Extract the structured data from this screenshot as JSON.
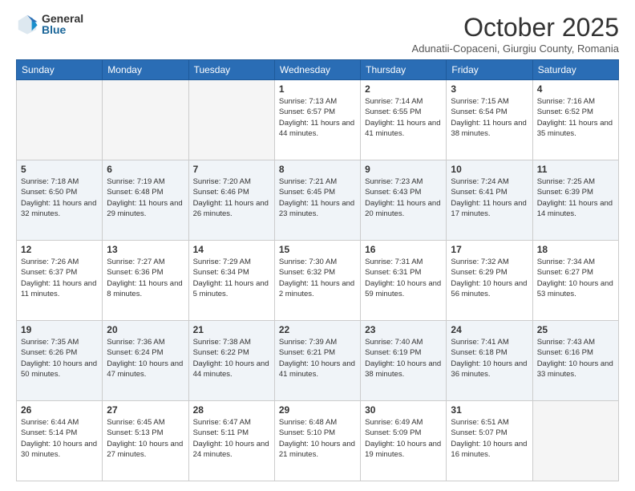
{
  "logo": {
    "general": "General",
    "blue": "Blue"
  },
  "header": {
    "month": "October 2025",
    "subtitle": "Adunatii-Copaceni, Giurgiu County, Romania"
  },
  "weekdays": [
    "Sunday",
    "Monday",
    "Tuesday",
    "Wednesday",
    "Thursday",
    "Friday",
    "Saturday"
  ],
  "weeks": [
    [
      {
        "day": "",
        "info": ""
      },
      {
        "day": "",
        "info": ""
      },
      {
        "day": "",
        "info": ""
      },
      {
        "day": "1",
        "info": "Sunrise: 7:13 AM\nSunset: 6:57 PM\nDaylight: 11 hours and 44 minutes."
      },
      {
        "day": "2",
        "info": "Sunrise: 7:14 AM\nSunset: 6:55 PM\nDaylight: 11 hours and 41 minutes."
      },
      {
        "day": "3",
        "info": "Sunrise: 7:15 AM\nSunset: 6:54 PM\nDaylight: 11 hours and 38 minutes."
      },
      {
        "day": "4",
        "info": "Sunrise: 7:16 AM\nSunset: 6:52 PM\nDaylight: 11 hours and 35 minutes."
      }
    ],
    [
      {
        "day": "5",
        "info": "Sunrise: 7:18 AM\nSunset: 6:50 PM\nDaylight: 11 hours and 32 minutes."
      },
      {
        "day": "6",
        "info": "Sunrise: 7:19 AM\nSunset: 6:48 PM\nDaylight: 11 hours and 29 minutes."
      },
      {
        "day": "7",
        "info": "Sunrise: 7:20 AM\nSunset: 6:46 PM\nDaylight: 11 hours and 26 minutes."
      },
      {
        "day": "8",
        "info": "Sunrise: 7:21 AM\nSunset: 6:45 PM\nDaylight: 11 hours and 23 minutes."
      },
      {
        "day": "9",
        "info": "Sunrise: 7:23 AM\nSunset: 6:43 PM\nDaylight: 11 hours and 20 minutes."
      },
      {
        "day": "10",
        "info": "Sunrise: 7:24 AM\nSunset: 6:41 PM\nDaylight: 11 hours and 17 minutes."
      },
      {
        "day": "11",
        "info": "Sunrise: 7:25 AM\nSunset: 6:39 PM\nDaylight: 11 hours and 14 minutes."
      }
    ],
    [
      {
        "day": "12",
        "info": "Sunrise: 7:26 AM\nSunset: 6:37 PM\nDaylight: 11 hours and 11 minutes."
      },
      {
        "day": "13",
        "info": "Sunrise: 7:27 AM\nSunset: 6:36 PM\nDaylight: 11 hours and 8 minutes."
      },
      {
        "day": "14",
        "info": "Sunrise: 7:29 AM\nSunset: 6:34 PM\nDaylight: 11 hours and 5 minutes."
      },
      {
        "day": "15",
        "info": "Sunrise: 7:30 AM\nSunset: 6:32 PM\nDaylight: 11 hours and 2 minutes."
      },
      {
        "day": "16",
        "info": "Sunrise: 7:31 AM\nSunset: 6:31 PM\nDaylight: 10 hours and 59 minutes."
      },
      {
        "day": "17",
        "info": "Sunrise: 7:32 AM\nSunset: 6:29 PM\nDaylight: 10 hours and 56 minutes."
      },
      {
        "day": "18",
        "info": "Sunrise: 7:34 AM\nSunset: 6:27 PM\nDaylight: 10 hours and 53 minutes."
      }
    ],
    [
      {
        "day": "19",
        "info": "Sunrise: 7:35 AM\nSunset: 6:26 PM\nDaylight: 10 hours and 50 minutes."
      },
      {
        "day": "20",
        "info": "Sunrise: 7:36 AM\nSunset: 6:24 PM\nDaylight: 10 hours and 47 minutes."
      },
      {
        "day": "21",
        "info": "Sunrise: 7:38 AM\nSunset: 6:22 PM\nDaylight: 10 hours and 44 minutes."
      },
      {
        "day": "22",
        "info": "Sunrise: 7:39 AM\nSunset: 6:21 PM\nDaylight: 10 hours and 41 minutes."
      },
      {
        "day": "23",
        "info": "Sunrise: 7:40 AM\nSunset: 6:19 PM\nDaylight: 10 hours and 38 minutes."
      },
      {
        "day": "24",
        "info": "Sunrise: 7:41 AM\nSunset: 6:18 PM\nDaylight: 10 hours and 36 minutes."
      },
      {
        "day": "25",
        "info": "Sunrise: 7:43 AM\nSunset: 6:16 PM\nDaylight: 10 hours and 33 minutes."
      }
    ],
    [
      {
        "day": "26",
        "info": "Sunrise: 6:44 AM\nSunset: 5:14 PM\nDaylight: 10 hours and 30 minutes."
      },
      {
        "day": "27",
        "info": "Sunrise: 6:45 AM\nSunset: 5:13 PM\nDaylight: 10 hours and 27 minutes."
      },
      {
        "day": "28",
        "info": "Sunrise: 6:47 AM\nSunset: 5:11 PM\nDaylight: 10 hours and 24 minutes."
      },
      {
        "day": "29",
        "info": "Sunrise: 6:48 AM\nSunset: 5:10 PM\nDaylight: 10 hours and 21 minutes."
      },
      {
        "day": "30",
        "info": "Sunrise: 6:49 AM\nSunset: 5:09 PM\nDaylight: 10 hours and 19 minutes."
      },
      {
        "day": "31",
        "info": "Sunrise: 6:51 AM\nSunset: 5:07 PM\nDaylight: 10 hours and 16 minutes."
      },
      {
        "day": "",
        "info": ""
      }
    ]
  ]
}
